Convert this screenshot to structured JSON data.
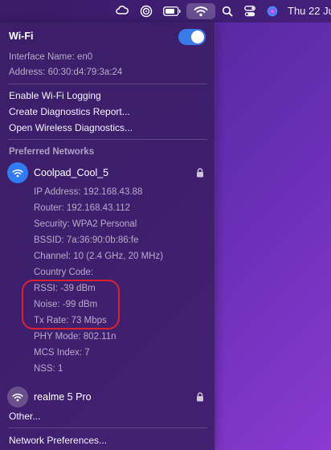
{
  "menubar": {
    "datetime": "Thu 22 Ju",
    "icons": [
      "creative-cloud-icon",
      "airplay-icon",
      "battery-icon",
      "wifi-icon",
      "search-icon",
      "control-center-icon",
      "siri-icon"
    ]
  },
  "wifi_menu": {
    "title": "Wi-Fi",
    "toggle_on": true,
    "interface_name": "Interface Name: en0",
    "address": "Address: 60:30:d4:79:3a:24",
    "actions": [
      "Enable Wi-Fi Logging",
      "Create Diagnostics Report...",
      "Open Wireless Diagnostics..."
    ],
    "preferred_section": "Preferred Networks",
    "networks": [
      {
        "name": "Coolpad_Cool_5",
        "connected": true,
        "details": [
          "IP Address: 192.168.43.88",
          "Router: 192.168.43.112",
          "Security: WPA2 Personal",
          "BSSID: 7a:36:90:0b:86:fe",
          "Channel: 10 (2.4 GHz, 20 MHz)",
          "Country Code:",
          "RSSI: -39 dBm",
          "Noise: -99 dBm",
          "Tx Rate: 73 Mbps",
          "PHY Mode: 802.11n",
          "MCS Index: 7",
          "NSS: 1"
        ]
      },
      {
        "name": "realme 5 Pro",
        "connected": false
      }
    ],
    "other": "Other...",
    "preferences": "Network Preferences..."
  },
  "colors": {
    "accent": "#2f7cf6",
    "toggle": "#3a7bea",
    "highlight": "#d9232e"
  }
}
